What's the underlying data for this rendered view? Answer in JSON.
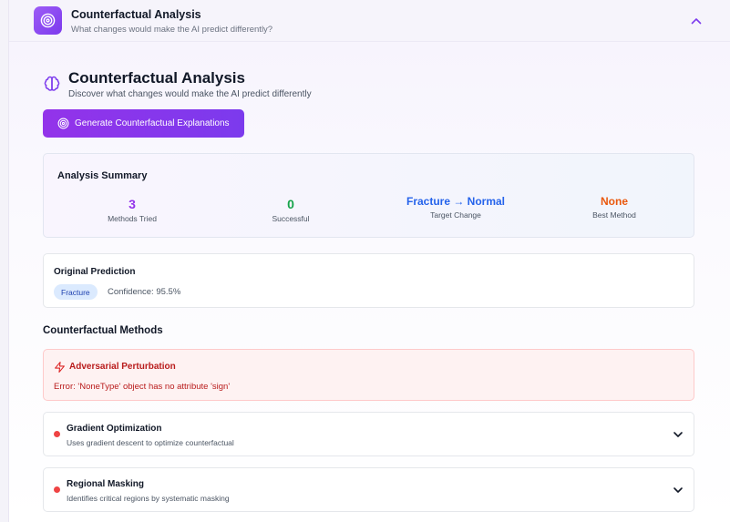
{
  "header": {
    "title": "Counterfactual Analysis",
    "subtitle": "What changes would make the AI predict differently?",
    "icon": "target-icon",
    "collapse_icon": "chevron-up-icon"
  },
  "main": {
    "icon": "brain-icon",
    "title": "Counterfactual Analysis",
    "subtitle": "Discover what changes would make the AI predict differently",
    "generate_button": "Generate Counterfactual Explanations",
    "generate_icon": "target-icon"
  },
  "summary": {
    "title": "Analysis Summary",
    "stats": [
      {
        "value": "3",
        "label": "Methods Tried",
        "color": "#9333ea"
      },
      {
        "value": "0",
        "label": "Successful",
        "color": "#16a34a"
      },
      {
        "value": "Fracture → Normal",
        "label": "Target Change",
        "color": "#2563eb"
      },
      {
        "value": "None",
        "label": "Best Method",
        "color": "#ea580c"
      }
    ]
  },
  "original_prediction": {
    "title": "Original Prediction",
    "badge": "Fracture",
    "confidence": "Confidence: 95.5%"
  },
  "methods": {
    "title": "Counterfactual Methods",
    "error": {
      "title": "Adversarial Perturbation",
      "message": "Error: 'NoneType' object has no attribute 'sign'",
      "icon": "lightning-icon"
    },
    "items": [
      {
        "title": "Gradient Optimization",
        "subtitle": "Uses gradient descent to optimize counterfactual",
        "status_color": "#ef4444"
      },
      {
        "title": "Regional Masking",
        "subtitle": "Identifies critical regions by systematic masking",
        "status_color": "#ef4444"
      }
    ]
  },
  "colors": {
    "accent": "#7c3aed",
    "error": "#b91c1c"
  }
}
